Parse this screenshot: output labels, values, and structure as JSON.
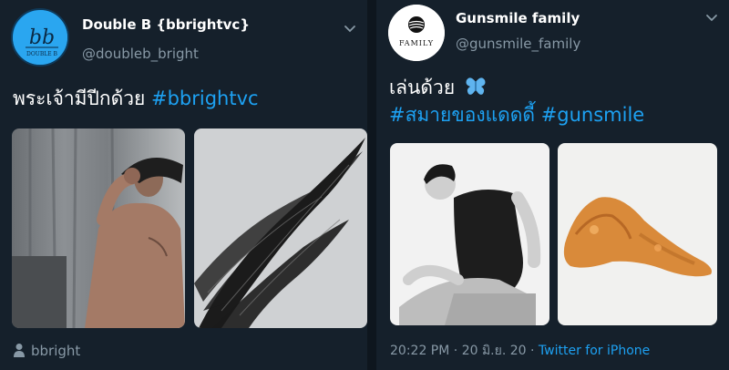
{
  "left_tweet": {
    "avatar_monogram": "bb",
    "avatar_caption": "DOUBLE B",
    "display_name": "Double B {bbrightvc}",
    "username": "@doubleb_bright",
    "text": "พระเจ้ามีปีกด้วย",
    "hashtag": "#bbrightvc",
    "footer_user": "bbright",
    "icons": [
      "chevron-down-icon",
      "person-icon"
    ],
    "photos": [
      "photo-shirtless-man",
      "photo-black-wing"
    ]
  },
  "right_tweet": {
    "avatar_brand": "FAMILY",
    "display_name": "Gunsmile family",
    "username": "@gunsmile_family",
    "text": "เล่นด้วย",
    "emoji": "butterfly",
    "hashtags": "#สมายของแดดดี้ #gunsmile",
    "time": "20:22 PM",
    "date": "20 มิ.ย. 20",
    "separator": "·",
    "source": "Twitter for iPhone",
    "icons": [
      "chevron-down-icon",
      "butterfly-icon"
    ],
    "photos": [
      "photo-man-sitting",
      "photo-chicken-wing"
    ]
  },
  "colors": {
    "background": "#15202b",
    "accent": "#1da1f2",
    "secondary_text": "#8899a6"
  }
}
